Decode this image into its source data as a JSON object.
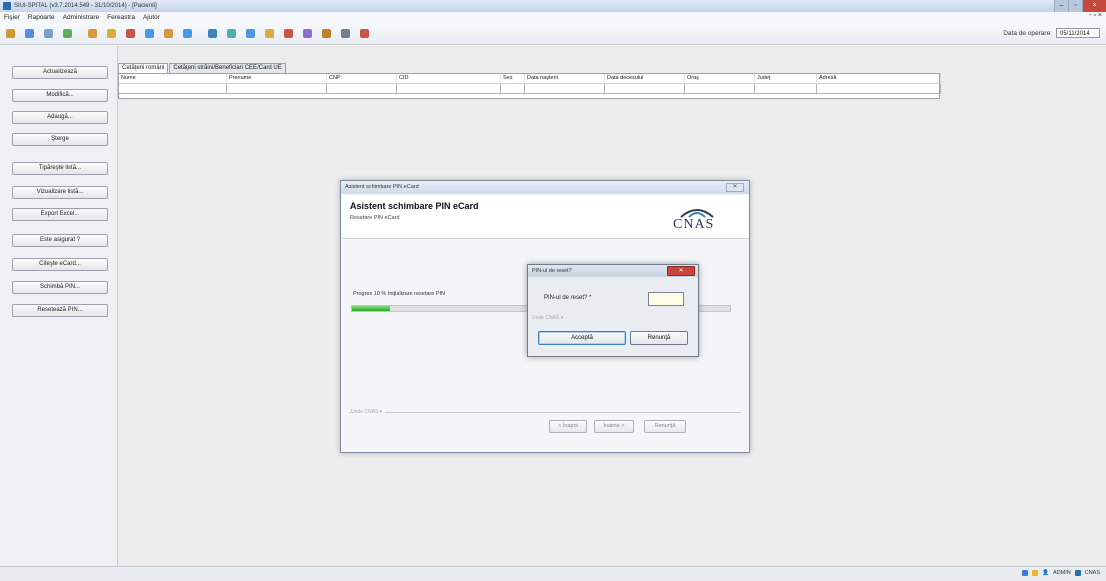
{
  "window": {
    "title": "SIUI-SPITAL (v3.7.2014.549 - 31/10/2014) - [Pacienti]",
    "app_icon_color": "#2a6ab8"
  },
  "menu": {
    "items": [
      "Fişier",
      "Rapoarte",
      "Administrare",
      "Fereastra",
      "Ajutor"
    ],
    "mdi_controls": "- ▫ ×"
  },
  "toolbar": {
    "icons": [
      {
        "name": "open-folder-icon",
        "color": "#c98a16"
      },
      {
        "name": "save-icon",
        "color": "#3a7bd5"
      },
      {
        "name": "document-icon",
        "color": "#6a8fbf"
      },
      {
        "name": "refresh-icon",
        "color": "#4aa04a"
      },
      {
        "name": "user-icon",
        "color": "#d08a1e"
      },
      {
        "name": "books-icon",
        "color": "#d0a020"
      },
      {
        "name": "report-icon",
        "color": "#c0392b"
      },
      {
        "name": "report-export-icon",
        "color": "#2e86de"
      },
      {
        "name": "user-add-icon",
        "color": "#d08a1e"
      },
      {
        "name": "users-icon",
        "color": "#2e86de"
      },
      {
        "name": "globe-icon",
        "color": "#1f6fb2"
      },
      {
        "name": "calendar-icon",
        "color": "#3aa0a0"
      },
      {
        "name": "users-group-icon",
        "color": "#2e86de"
      },
      {
        "name": "books-stack-icon",
        "color": "#d0a020"
      },
      {
        "name": "chart-report-icon",
        "color": "#c0392b"
      },
      {
        "name": "card-icon",
        "color": "#7e57c2"
      },
      {
        "name": "wrench-icon",
        "color": "#b36b00"
      },
      {
        "name": "gear-icon",
        "color": "#5a6c80"
      },
      {
        "name": "print-report-icon",
        "color": "#c0392b"
      }
    ],
    "operation_date_label": "Data de operare:",
    "operation_date_value": "05/11/2014"
  },
  "sidebar": {
    "buttons": [
      "Actualizează",
      "Modifică...",
      "Adaugă...",
      "Şterge",
      "Tipăreşte listă...",
      "Vizualizare listă...",
      "Export Excel...",
      "Este asigurat ?",
      "Citeşte eCard...",
      "Schimbă PIN...",
      "Resetează PIN..."
    ]
  },
  "tabs": {
    "items": [
      "Cetăţeni români",
      "Cetăţeni străini/Beneficiari CEE/Card UE"
    ],
    "active": 0
  },
  "grid": {
    "columns": [
      "Nume",
      "Prenume",
      "CNP",
      "CID",
      "Sex",
      "Data naşterii",
      "Data decesului",
      "Oraş",
      "Judeţ",
      "Adresă"
    ]
  },
  "wizard": {
    "window_title": "Asistent schimbare PIN eCard",
    "close_glyph": "✕",
    "heading": "Asistent schimbare PIN eCard",
    "subheading": "Resetare PIN eCard",
    "logo_text": "CNAS",
    "progress_text": "Progres 10 % Iniţializare resetare PIN",
    "progress_percent": 10,
    "group_label": "Unde CNAS ▾",
    "buttons": [
      "< Înapoi",
      "Înainte >",
      "Renunţă"
    ]
  },
  "pin_dialog": {
    "title": "PIN-ul de reset?",
    "close_glyph": "✕",
    "label": "PIN-ul de reset? *",
    "value": "",
    "group_label": "Unde CNAS ▾",
    "buttons": {
      "accept": "Acceptă",
      "cancel": "Renunţă"
    }
  },
  "statusbar": {
    "user": "ADMIN",
    "org": "CNAS"
  }
}
